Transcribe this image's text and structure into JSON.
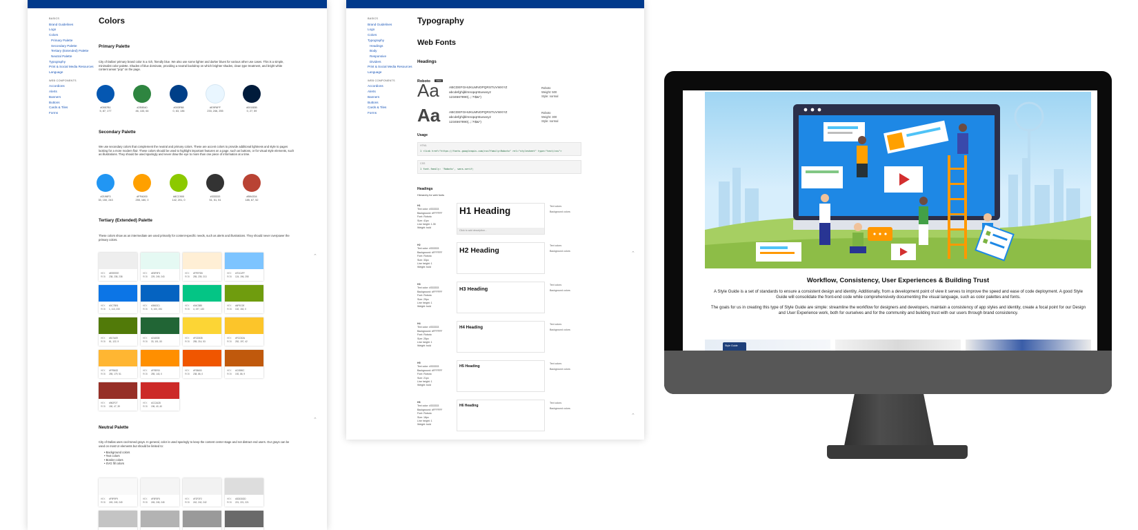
{
  "colors_page": {
    "nav": {
      "basics_heading": "BASICS",
      "items": [
        {
          "label": "Brand Guidelines",
          "sub": false
        },
        {
          "label": "Logo",
          "sub": false
        },
        {
          "label": "Colors",
          "sub": false
        },
        {
          "label": "Primary Palette",
          "sub": true
        },
        {
          "label": "Secondary Palette",
          "sub": true
        },
        {
          "label": "Tertiary (Extended) Palette",
          "sub": true
        },
        {
          "label": "Neutral Palette",
          "sub": true
        },
        {
          "label": "Typography",
          "sub": false
        },
        {
          "label": "Print & Social Media Resources",
          "sub": false
        },
        {
          "label": "Language",
          "sub": false
        }
      ],
      "web_heading": "WEB COMPONENTS",
      "web_items": [
        "Accordions",
        "Alerts",
        "Banners",
        "Buttons",
        "Cards & Tiles",
        "Forms"
      ]
    },
    "title": "Colors",
    "primary": {
      "heading": "Primary Palette",
      "text": "City of Dallas' primary brand color is a rich, friendly blue. We also use some lighter and darker blues for various other use cases. This is a simple, minimalist color palette. Shades of blue dominate, providing a neutral backdrop on which brighter shades, clean type treatment, and bright white content areas \"pop\" on the page.",
      "swatches": [
        {
          "color": "#0557B1",
          "hex": "#0557B1",
          "rgb": "5, 87, 177"
        },
        {
          "color": "#2E8540",
          "hex": "#2E8540",
          "rgb": "46, 133, 64"
        },
        {
          "color": "#003F88",
          "hex": "#003F88",
          "rgb": "0, 63, 136"
        },
        {
          "color": "#E9F6FF",
          "hex": "#E9F6FF",
          "rgb": "233, 246, 255"
        },
        {
          "color": "#001B3B",
          "hex": "#001B3B",
          "rgb": "0, 27, 59"
        }
      ]
    },
    "secondary": {
      "heading": "Secondary Palette",
      "text": "We use secondary colors that complement the neutral and primary colors. These are accent colors to provide additional lightness and style to pages looking for a more modern flair. These colors should be used to highlight important features on a page, such as buttons, or for visual style elements, such as illustrations. They should be used sparingly and never draw the eye to more than one piece of information at a time.",
      "swatches": [
        {
          "color": "#2196F3",
          "hex": "#2196F3",
          "rgb": "33, 150, 243"
        },
        {
          "color": "#FFA000",
          "hex": "#FFA000",
          "rgb": "255, 160, 0"
        },
        {
          "color": "#8CC900",
          "hex": "#8CC900",
          "rgb": "142, 201, 0"
        },
        {
          "color": "#333333",
          "hex": "#333333",
          "rgb": "51, 51, 51"
        },
        {
          "color": "#B94334",
          "hex": "#B94334",
          "rgb": "185, 67, 52"
        }
      ]
    },
    "tertiary": {
      "heading": "Tertiary (Extended) Palette",
      "text": "These colors show as an intermediate are used primarily for content-specific needs, such as alerts and illustrations. They should never overpower the primary colors.",
      "hex_label": "HEX",
      "rgb_label": "RGB",
      "cards": [
        {
          "color": "#EEEEEE",
          "hex": "#EEEEEE",
          "rgb": "238, 238, 238"
        },
        {
          "color": "#E5F9F3",
          "hex": "#E5F9F3",
          "rgb": "229, 249, 243"
        },
        {
          "color": "#FFEFD5",
          "hex": "#FFEFD5",
          "rgb": "255, 239, 213"
        },
        {
          "color": "#7DC4FF",
          "hex": "#7DC4FF",
          "rgb": "124, 196, 255"
        },
        {
          "color": "#0C75E6",
          "hex": "#0C75E6",
          "rgb": "1, 113, 230"
        },
        {
          "color": "#0563C1",
          "hex": "#0563C1",
          "rgb": "5, 100, 194"
        },
        {
          "color": "#04C585",
          "hex": "#04C585",
          "rgb": "4, 197, 133"
        },
        {
          "color": "#6F9C0E",
          "hex": "#6F9C0E",
          "rgb": "102, 152, 0"
        },
        {
          "color": "#517A09",
          "hex": "#517A09",
          "rgb": "81, 122, 9"
        },
        {
          "color": "#216535",
          "hex": "#216535",
          "rgb": "33, 101, 53"
        },
        {
          "color": "#FCD535",
          "hex": "#FCD535",
          "rgb": "255, 214, 53"
        },
        {
          "color": "#FCC52A",
          "hex": "#FCC52A",
          "rgb": "252, 197, 42"
        },
        {
          "color": "#FFB632",
          "hex": "#FFB632",
          "rgb": "255, 179, 51"
        },
        {
          "color": "#FF8F00",
          "hex": "#FF8F00",
          "rgb": "255, 143, 0"
        },
        {
          "color": "#F05600",
          "hex": "#F05600",
          "rgb": "238, 86, 0"
        },
        {
          "color": "#C0590C",
          "hex": "#C0590C",
          "rgb": "192, 86, 9"
        },
        {
          "color": "#962F27",
          "hex": "#962F27",
          "rgb": "150, 47, 39"
        },
        {
          "color": "#CC2A28",
          "hex": "#CC2A28",
          "rgb": "196, 40, 40"
        }
      ]
    },
    "neutral": {
      "heading": "Neutral Palette",
      "text": "City of Dallas uses cool-toned grays. In general, color is used sparingly to keep the content center stage and not distract end users. Our grays can be used on most UI elements but should be limited to:",
      "bullets": [
        "Background colors",
        "Text colors",
        "Border colors",
        "SVG fill colors"
      ],
      "cards": [
        {
          "color": "#F9F9F9",
          "hex": "#F9F9F9",
          "rgb": "249, 249, 249"
        },
        {
          "color": "#F5F5F5",
          "hex": "#F5F5F5",
          "rgb": "245, 245, 245"
        },
        {
          "color": "#F2F2F2",
          "hex": "#F2F2F2",
          "rgb": "242, 242, 242"
        },
        {
          "color": "#DDDDDD",
          "hex": "#DDDDDD",
          "rgb": "221, 221, 221"
        },
        {
          "color": "#C4C4C4",
          "hex": "",
          "rgb": ""
        },
        {
          "color": "#B3B3B3",
          "hex": "",
          "rgb": ""
        },
        {
          "color": "#9A9A9A",
          "hex": "",
          "rgb": ""
        },
        {
          "color": "#6A6A6A",
          "hex": "",
          "rgb": ""
        }
      ]
    }
  },
  "typography_page": {
    "nav": {
      "basics_heading": "BASICS",
      "items": [
        {
          "label": "Brand Guidelines",
          "sub": false
        },
        {
          "label": "Logo",
          "sub": false
        },
        {
          "label": "Colors",
          "sub": false
        },
        {
          "label": "Typography",
          "sub": false
        },
        {
          "label": "Headings",
          "sub": true
        },
        {
          "label": "Body",
          "sub": true
        },
        {
          "label": "Responsive",
          "sub": true
        },
        {
          "label": "Dividers",
          "sub": true
        },
        {
          "label": "Print & Social Media Resources",
          "sub": false
        },
        {
          "label": "Language",
          "sub": false
        }
      ],
      "web_heading": "WEB COMPONENTS",
      "web_items": [
        "Accordions",
        "Alerts",
        "Banners",
        "Buttons",
        "Cards & Tiles",
        "Forms"
      ]
    },
    "title": "Typography",
    "web_fonts": "Web Fonts",
    "headings_label": "Headings",
    "font_name": "Roboto",
    "font_badge": "FREE",
    "specimens": [
      {
        "aa": "Aa",
        "upper": "ABCDEFGHIJKLMNOPQRSTUVWXYZ",
        "lower": "abcdefghijklmnopqrstuvwxyz",
        "digits": "1234567890(,.;:?!$&*)",
        "family": "Roboto",
        "weight": "Weight: 500",
        "style": "Style: normal"
      },
      {
        "aa": "Aa",
        "upper": "ABCDEFGHIJKLMNOPQRSTUVWXYZ",
        "lower": "abcdefghijklmnopqrstuvwxyz",
        "digits": "1234567890(,.;:?!$&*)",
        "family": "Roboto",
        "weight": "Weight: 300",
        "style": "Style: normal"
      }
    ],
    "usage_label": "Usage",
    "code_html_label": "HTML",
    "code_html": "1  <link href=\"https://fonts.googleapis.com/css?family=Roboto\" rel=\"stylesheet\" type=\"text/css\">",
    "code_css_label": "CSS",
    "code_css": "1  font-family: 'Roboto', sans-serif;",
    "hier_title": "Headings",
    "hier_sub": "Hierarchy for web fonts",
    "text_colors": "Text colors",
    "bg_colors": "Background colors",
    "desc_placeholder": "Click to add description...",
    "levels": [
      {
        "tag": "H1",
        "text_color": "Text color: #333333",
        "bg": "Background: #FFFFFF",
        "font": "Font: Roboto",
        "size": "Size: 41px",
        "lh": "Line height: 1.35",
        "weight": "Weight: bold",
        "sample": "H1 Heading"
      },
      {
        "tag": "H2",
        "text_color": "Text color: #333333",
        "bg": "Background: #FFFFFF",
        "font": "Font: Roboto",
        "size": "Size: 33px",
        "lh": "Line height: 1",
        "weight": "Weight: bold",
        "sample": "H2 Heading"
      },
      {
        "tag": "H3",
        "text_color": "Text color: #333333",
        "bg": "Background: #FFFFFF",
        "font": "Font: Roboto",
        "size": "Size: 29px",
        "lh": "Line height: 1",
        "weight": "Weight: bold",
        "sample": "H3 Heading"
      },
      {
        "tag": "H4",
        "text_color": "Text color: #333333",
        "bg": "Background: #FFFFFF",
        "font": "Font: Roboto",
        "size": "Size: 25px",
        "lh": "Line height: 1",
        "weight": "Weight: bold",
        "sample": "H4 Heading"
      },
      {
        "tag": "H5",
        "text_color": "Text color: #333333",
        "bg": "Background: #FFFFFF",
        "font": "Font: Roboto",
        "size": "Size: 21px",
        "lh": "Line height: 1",
        "weight": "Weight: bold",
        "sample": "H5 Heading"
      },
      {
        "tag": "H6",
        "text_color": "Text color: #333333",
        "bg": "Background: #FFFFFF",
        "font": "Font: Roboto",
        "size": "Size: 18px",
        "lh": "Line height: 1",
        "weight": "Weight: bold",
        "sample": "H6 Heading"
      }
    ]
  },
  "monitor_site": {
    "heading": "Workflow, Consistency, User Experiences & Building Trust",
    "para1": "A Style Guide is a set of standards to ensure a consistent design and identity. Additionally, from a development point of view it serves to improve the speed and ease of code deployment. A good Style Guide will consolidate the front-end code while comprehensively documenting the visual language, such as color palettes and fonts.",
    "para2": "The goals for us in creating this type of Style Guide are simple: streamline the workflow for designers and developers, maintain a consistency of app styles and identity, create a focal point for our Design and User Experience work, both for ourselves and for the community and building trust with our users through brand consistency.",
    "thumb_label": "Style Guide"
  }
}
